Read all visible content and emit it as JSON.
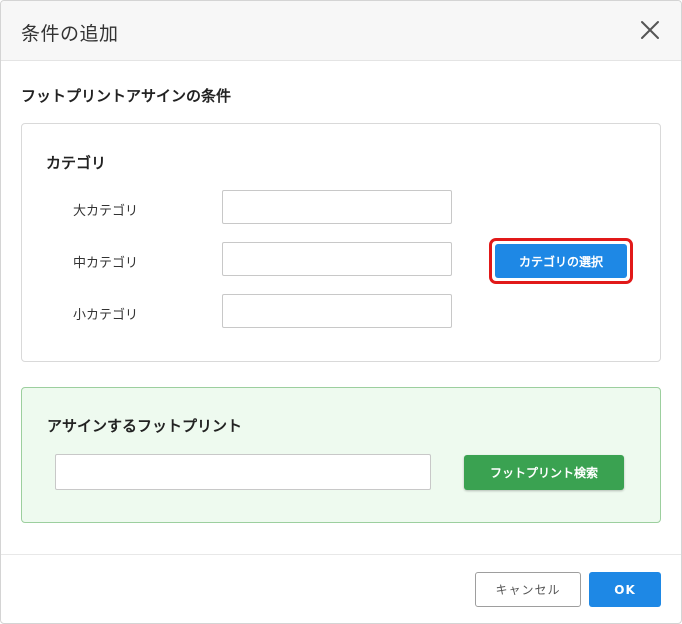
{
  "dialog": {
    "title": "条件の追加",
    "close_icon": "close-icon"
  },
  "section": {
    "title": "フットプリントアサインの条件"
  },
  "category": {
    "heading": "カテゴリ",
    "fields": [
      {
        "label": "大カテゴリ",
        "value": ""
      },
      {
        "label": "中カテゴリ",
        "value": ""
      },
      {
        "label": "小カテゴリ",
        "value": ""
      }
    ],
    "select_button_label": "カテゴリの選択",
    "highlight_color": "#e11919",
    "button_color": "#1e88e5"
  },
  "footprint": {
    "heading": "アサインするフットプリント",
    "input_value": "",
    "search_button_label": "フットプリント検索",
    "button_color": "#3aa251",
    "panel_color": "#eefaef"
  },
  "footer": {
    "cancel_label": "キャンセル",
    "ok_label": "OK"
  }
}
